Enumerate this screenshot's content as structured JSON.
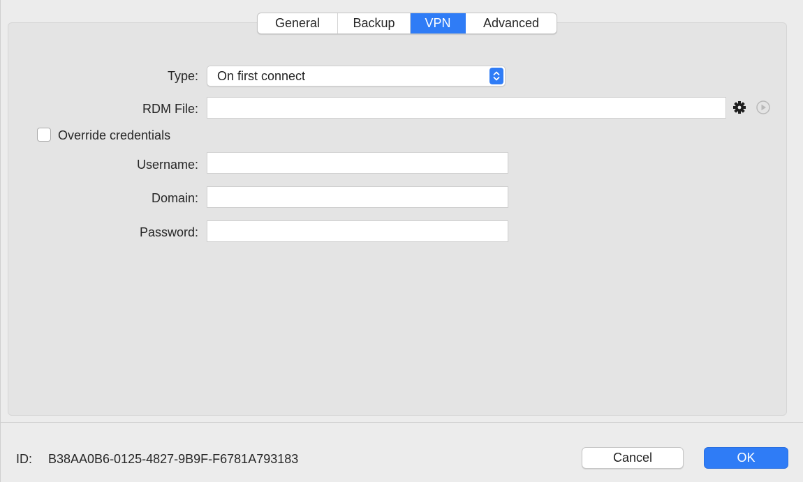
{
  "tabs": [
    {
      "label": "General"
    },
    {
      "label": "Backup"
    },
    {
      "label": "VPN",
      "active": true
    },
    {
      "label": "Advanced"
    }
  ],
  "form": {
    "type_label": "Type:",
    "type_value": "On first connect",
    "rdm_file_label": "RDM File:",
    "rdm_file_value": "",
    "override_label": "Override credentials",
    "override_checked": false,
    "username_label": "Username:",
    "username_value": "",
    "domain_label": "Domain:",
    "domain_value": "",
    "password_label": "Password:",
    "password_value": ""
  },
  "footer": {
    "id_label": "ID:",
    "id_value": "B38AA0B6-0125-4827-9B9F-F6781A793183",
    "cancel_label": "Cancel",
    "ok_label": "OK"
  },
  "colors": {
    "accent": "#2f7cf6",
    "background": "#ececec",
    "panel": "#e4e4e4"
  },
  "icons": {
    "stepper": "chevron-up-down-icon",
    "gear": "gear-icon",
    "play": "play-circle-icon"
  }
}
